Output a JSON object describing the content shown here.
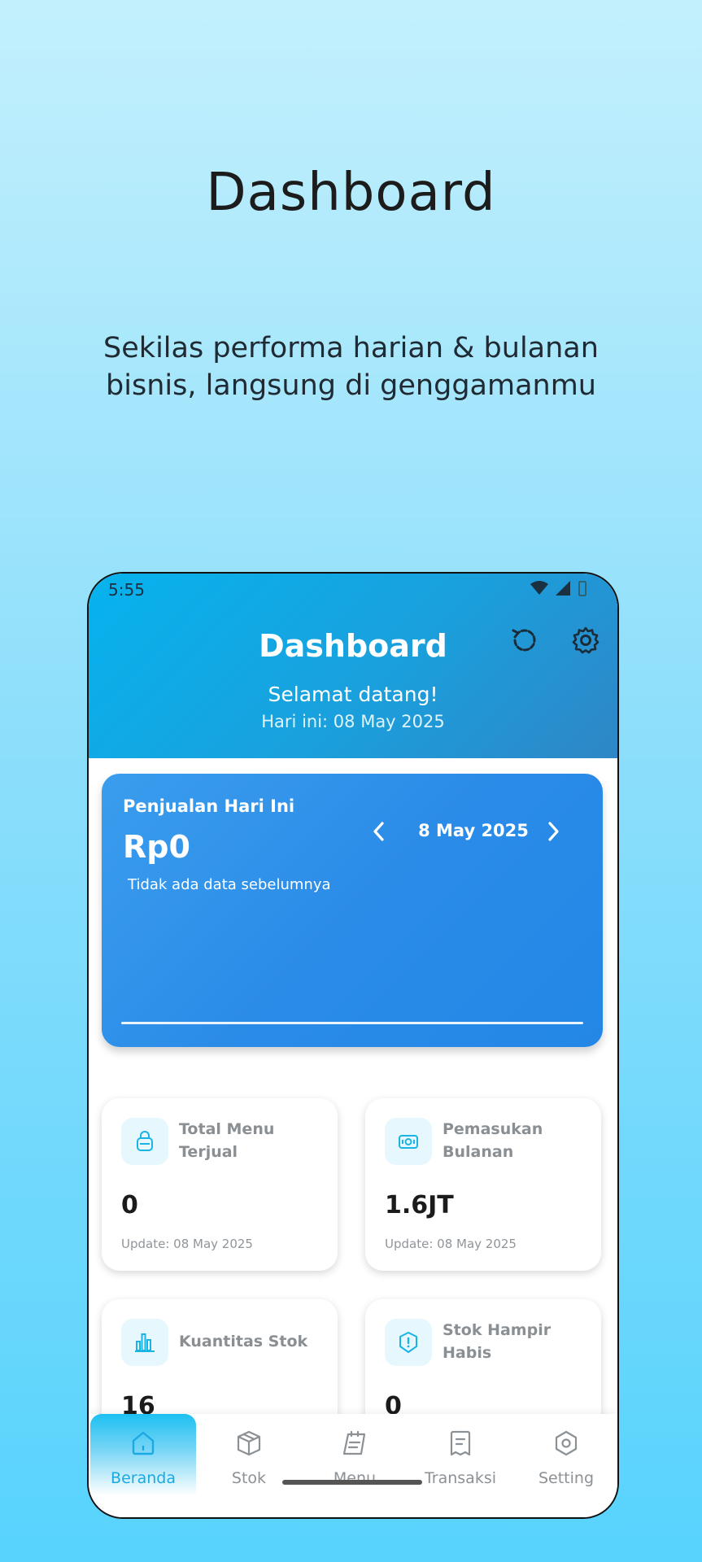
{
  "promo": {
    "title": "Dashboard",
    "subtitle": "Sekilas performa harian & bulanan bisnis, langsung di genggamanmu"
  },
  "status_bar": {
    "time": "5:55"
  },
  "header": {
    "title": "Dashboard",
    "welcome": "Selamat datang!",
    "today": "Hari ini: 08 May 2025",
    "icons": [
      "refresh-icon",
      "gear-icon"
    ]
  },
  "sales_card": {
    "label": "Penjualan Hari Ini",
    "value": "Rp0",
    "note": "Tidak ada data sebelumnya",
    "date": "8 May 2025"
  },
  "stats": [
    {
      "label": "Total Menu Terjual",
      "value": "0",
      "updated": "Update: 08 May 2025",
      "icon": "bag-icon"
    },
    {
      "label": "Pemasukan Bulanan",
      "value": "1.6JT",
      "updated": "Update: 08 May 2025",
      "icon": "money-icon"
    },
    {
      "label": "Kuantitas Stok",
      "value": "16",
      "updated": "",
      "icon": "bar-chart-icon"
    },
    {
      "label": "Stok Hampir Habis",
      "value": "0",
      "updated": "",
      "icon": "warning-icon"
    }
  ],
  "bottom_nav": [
    {
      "label": "Beranda",
      "icon": "home-icon",
      "active": true
    },
    {
      "label": "Stok",
      "icon": "box-icon",
      "active": false
    },
    {
      "label": "Menu",
      "icon": "menu-book-icon",
      "active": false
    },
    {
      "label": "Transaksi",
      "icon": "receipt-icon",
      "active": false
    },
    {
      "label": "Setting",
      "icon": "settings-icon",
      "active": false
    }
  ],
  "colors": {
    "accent": "#1aa9e3",
    "card_blue": "#2b8ce8",
    "header_start": "#06b3ee",
    "header_end": "#2f86c6"
  }
}
